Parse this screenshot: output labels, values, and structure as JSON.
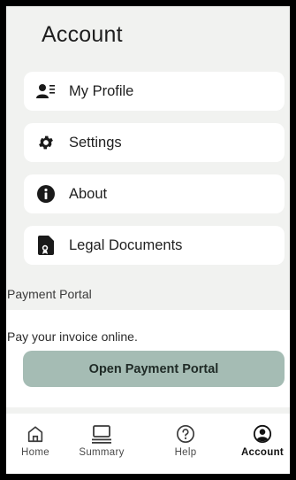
{
  "header": {
    "title": "Account"
  },
  "menu": [
    {
      "label": "My Profile",
      "icon": "profile-card-icon"
    },
    {
      "label": "Settings",
      "icon": "gear-icon"
    },
    {
      "label": "About",
      "icon": "info-icon"
    },
    {
      "label": "Legal Documents",
      "icon": "legal-document-icon"
    }
  ],
  "payment": {
    "section_label": "Payment Portal",
    "description": "Pay your invoice online.",
    "button_label": "Open Payment Portal"
  },
  "bottom_nav": [
    {
      "label": "Home",
      "icon": "home-icon",
      "active": false
    },
    {
      "label": "Summary",
      "icon": "summary-icon",
      "active": false
    },
    {
      "label": "Help",
      "icon": "help-icon",
      "active": false
    },
    {
      "label": "Account",
      "icon": "account-icon",
      "active": true
    }
  ],
  "colors": {
    "background": "#f1f2f0",
    "card": "#ffffff",
    "button": "#a5bcb4",
    "text": "#1f1f1f"
  }
}
